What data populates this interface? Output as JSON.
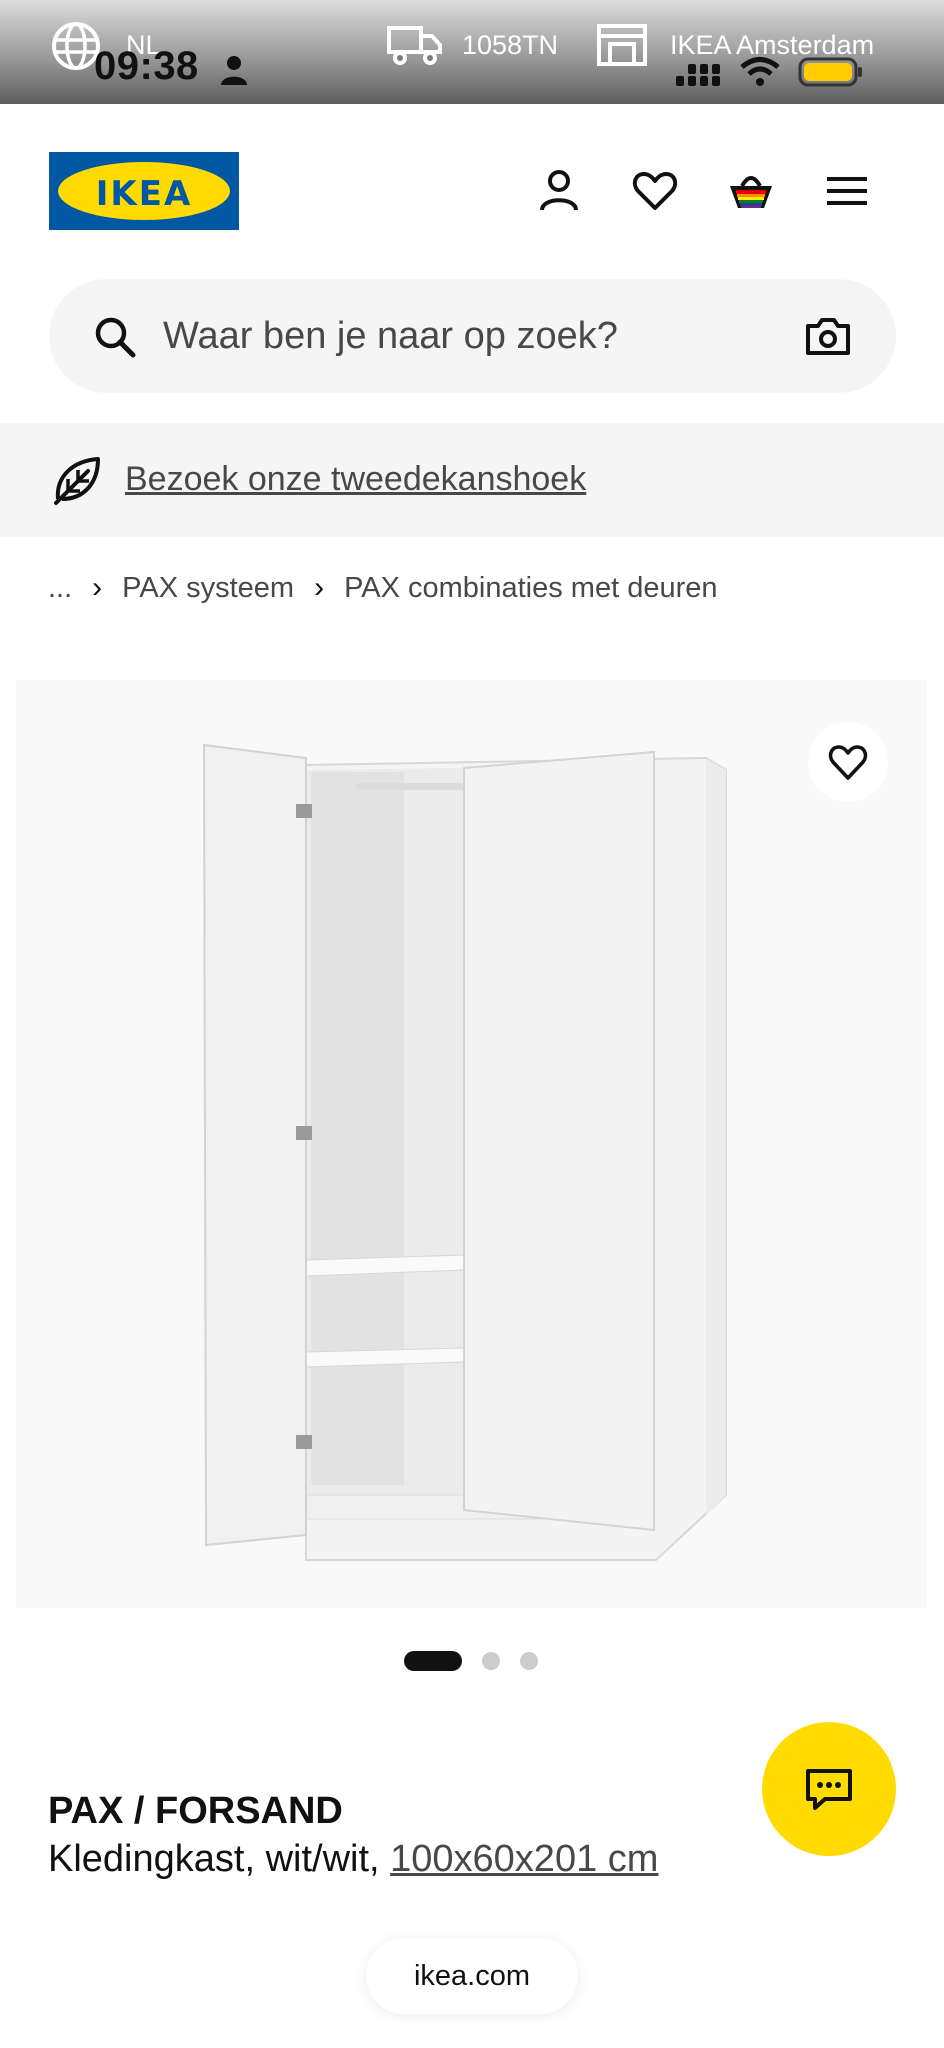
{
  "status_bar": {
    "language": "NL",
    "time": "09:38",
    "postcode": "1058TN",
    "store": "IKEA Amsterdam",
    "icons": [
      "globe-icon",
      "person-icon",
      "truck-icon",
      "store-icon",
      "signal-icon",
      "wifi-icon",
      "battery-icon"
    ]
  },
  "header": {
    "logo_text": "IKEA",
    "icons": [
      "profile-icon",
      "wishlist-icon",
      "cart-icon",
      "menu-icon"
    ]
  },
  "search": {
    "placeholder": "Waar ben je naar op zoek?"
  },
  "promo": {
    "link_text": "Bezoek onze tweedekanshoek"
  },
  "breadcrumb": {
    "ellipsis": "...",
    "items": [
      "PAX systeem",
      "PAX combinaties met deuren"
    ]
  },
  "carousel": {
    "total": 3,
    "active_index": 1
  },
  "product": {
    "name": "PAX / FORSAND",
    "description_prefix": "Kledingkast, wit/wit, ",
    "size_link": "100x60x201 cm"
  },
  "footer": {
    "domain": "ikea.com"
  },
  "colors": {
    "ikea_blue": "#0058a3",
    "ikea_yellow": "#ffdb00",
    "surface_gray": "#f5f5f5",
    "text_dark": "#111111",
    "text_muted": "#484848"
  }
}
